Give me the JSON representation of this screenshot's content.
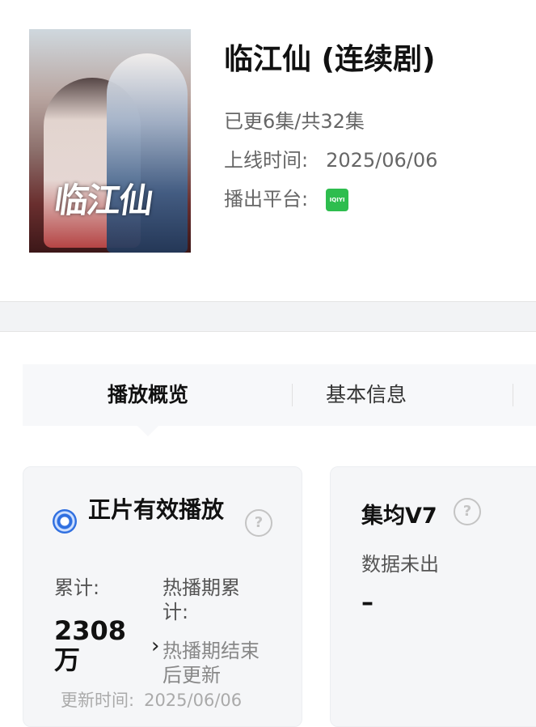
{
  "drama": {
    "title": "临江仙 (连续剧)",
    "poster_calligraphy": "临江仙",
    "episodes": "已更6集/共32集",
    "release_label": "上线时间:",
    "release_date": "2025/06/06",
    "platform_label": "播出平台:",
    "platform_icon": "iqiyi-logo-icon",
    "platform_badge_text": "IQIYI"
  },
  "tabs": {
    "items": [
      {
        "label": "播放概览",
        "active": true
      },
      {
        "label": "基本信息",
        "active": false
      }
    ]
  },
  "card_play": {
    "title": "正片有效播放",
    "cumulative_label": "累计:",
    "cumulative_value": "2308万",
    "hot_label": "热播期累计:",
    "hot_value": "热播期结束后更新",
    "update_label": "更新时间:",
    "update_value": "2025/06/06"
  },
  "card_v7": {
    "title": "集均V7",
    "status": "数据未出",
    "value": "–"
  },
  "colors": {
    "accent_blue": "#2f6fe0",
    "iqiyi_green": "#2ebd4e",
    "card_bg": "#f5f6f8"
  }
}
